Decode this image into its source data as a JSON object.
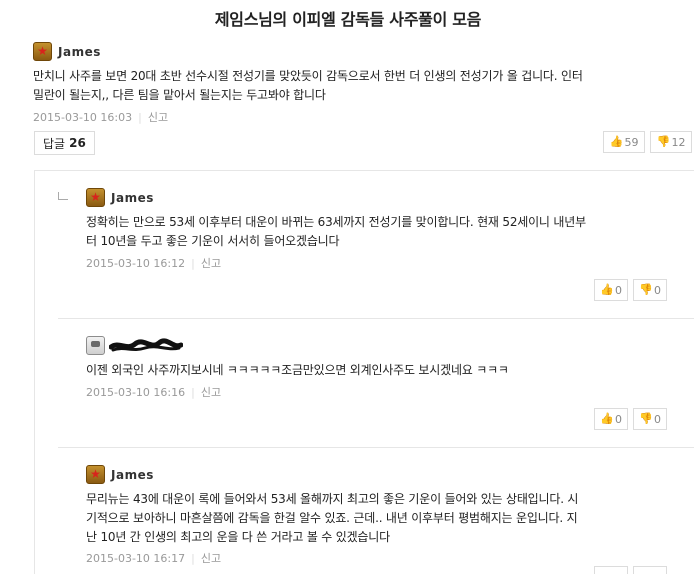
{
  "page": {
    "title": "제임스님의 이피엘 감독들 사주풀이 모음"
  },
  "main_post": {
    "author": "James",
    "text_line1": "만치니 사주를 보면 20대 초반 선수시절 전성기를 맞았듯이 감독으로서 한번 더 인생의 전성기가 올 겁니다. 인터",
    "text_line2": "밀란이 될는지,, 다른 팀을 맡아서 될는지는 두고봐야 합니다",
    "timestamp": "2015-03-10 16:03",
    "report_label": "신고",
    "like_count": "59",
    "dislike_count": "12",
    "reply_label": "답글",
    "reply_count": "26"
  },
  "replies": [
    {
      "author": "James",
      "text_line1": "정확히는 만으로 53세 이후부터 대운이 바뀌는 63세까지 전성기를 맞이합니다. 현재 52세이니 내년부",
      "text_line2": "터 10년을 두고 좋은 기운이 서서히 들어오겠습니다",
      "timestamp": "2015-03-10 16:12",
      "report_label": "신고",
      "like_count": "0",
      "dislike_count": "0"
    },
    {
      "author": "",
      "text_line1": "이젠 외국인 사주까지보시네 ㅋㅋㅋㅋㅋ조금만있으면 외계인사주도 보시겠네요 ㅋㅋㅋ",
      "timestamp": "2015-03-10 16:16",
      "report_label": "신고",
      "like_count": "0",
      "dislike_count": "0"
    },
    {
      "author": "James",
      "text_line1": "무리뉴는 43에 대운이 록에 들어와서 53세 올해까지 최고의 좋은 기운이 들어와 있는 상태입니다. 시",
      "text_line2": "기적으로 보아하니 마흔살쯤에 감독을 한걸 알수 있죠. 근데.. 내년 이후부터 평범해지는 운입니다. 지",
      "text_line3": "난 10년 간 인생의 최고의 운을 다 쓴 거라고 볼 수 있겠습니다",
      "timestamp": "2015-03-10 16:17",
      "report_label": "신고"
    }
  ],
  "icons": {
    "like": "thumbs-up-icon",
    "dislike": "thumbs-down-icon",
    "gold_badge": "gold-star-badge-icon",
    "gray_badge": "gray-badge-icon",
    "reply_elbow": "reply-indent-icon"
  },
  "colors": {
    "text": "#222222",
    "meta": "#999999",
    "border": "#dcdcdc",
    "badge_gold": "#b07d22",
    "badge_star": "#d8241c"
  }
}
